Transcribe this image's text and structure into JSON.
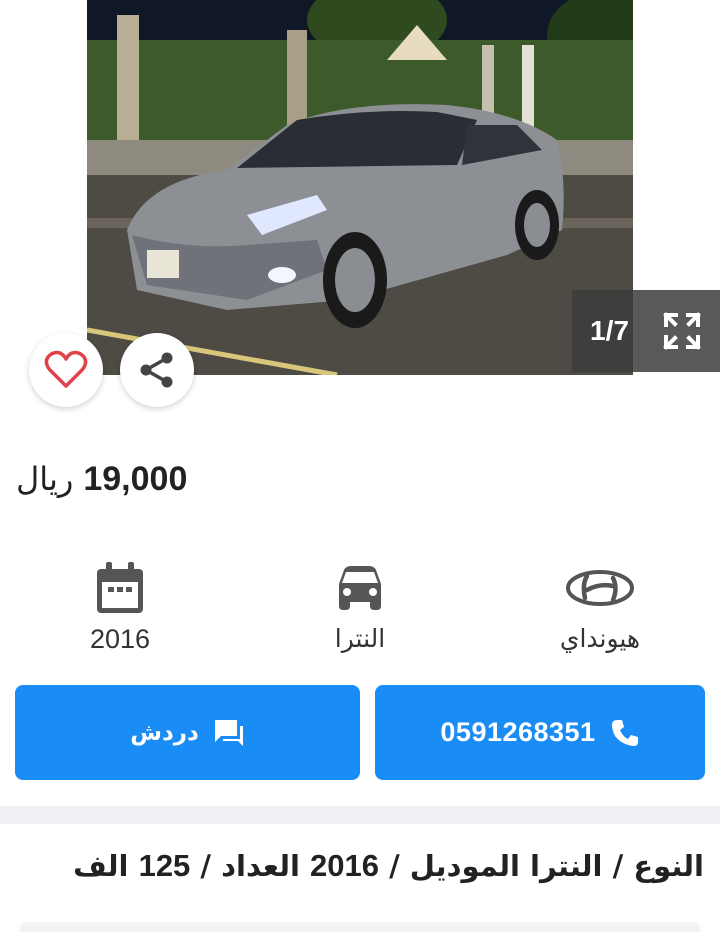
{
  "gallery": {
    "counter": "1/7",
    "prev_icon": "chevron-left-icon",
    "next_icon": "chevron-right-icon",
    "fullscreen_icon": "fullscreen-icon"
  },
  "actions": {
    "favorite_icon": "heart-icon",
    "share_icon": "share-icon"
  },
  "listing": {
    "price": "19,000",
    "currency": "ريال"
  },
  "specs": {
    "year": "2016",
    "model": "النترا",
    "make": "هيونداي"
  },
  "buttons": {
    "chat_label": "دردش",
    "phone": "0591268351"
  },
  "details": {
    "type_label": "النوع",
    "model_value": "النترا",
    "model_label": "الموديل",
    "year_value": "2016",
    "mileage_label": "العداد",
    "mileage_value": "125",
    "mileage_unit": "الف",
    "separator": "/"
  },
  "colors": {
    "primary": "#1a8cf5",
    "heart": "#e0424a",
    "divider": "#eef0f3"
  }
}
